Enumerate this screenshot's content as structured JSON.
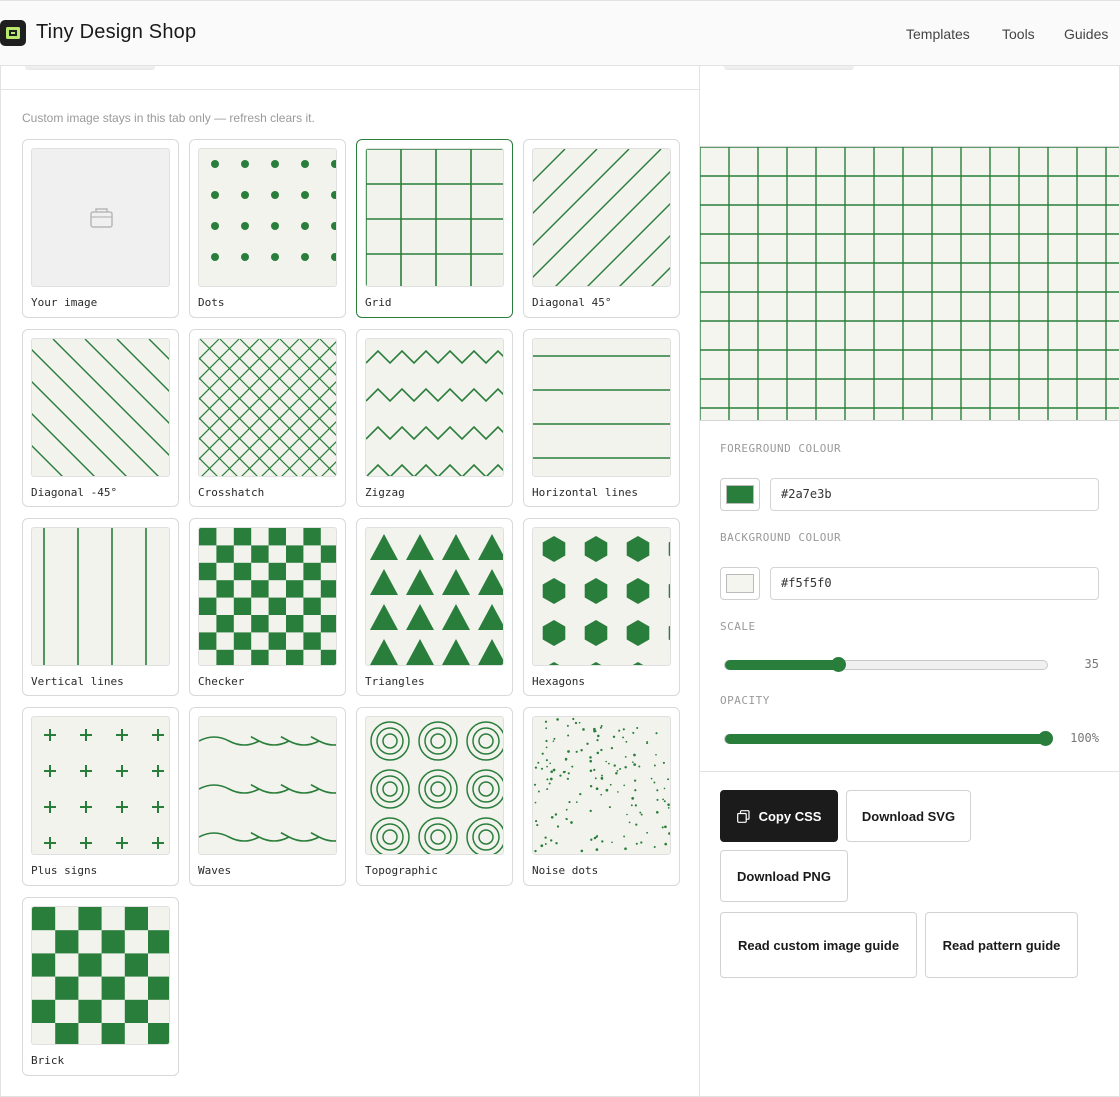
{
  "header": {
    "brand": "Tiny Design Shop",
    "nav": [
      "Templates",
      "Tools",
      "Guides"
    ]
  },
  "gallery": {
    "hint": "Custom image stays in this tab only — refresh clears it.",
    "selected": "Grid",
    "patterns": [
      {
        "label": "Your image"
      },
      {
        "label": "Dots"
      },
      {
        "label": "Grid"
      },
      {
        "label": "Diagonal 45°"
      },
      {
        "label": "Diagonal -45°"
      },
      {
        "label": "Crosshatch"
      },
      {
        "label": "Zigzag"
      },
      {
        "label": "Horizontal lines"
      },
      {
        "label": "Vertical lines"
      },
      {
        "label": "Checker"
      },
      {
        "label": "Triangles"
      },
      {
        "label": "Hexagons"
      },
      {
        "label": "Plus signs"
      },
      {
        "label": "Waves"
      },
      {
        "label": "Topographic"
      },
      {
        "label": "Noise dots"
      },
      {
        "label": "Brick"
      }
    ]
  },
  "controls": {
    "foreground": {
      "label": "FOREGROUND COLOUR",
      "value": "#2a7e3b"
    },
    "background": {
      "label": "BACKGROUND COLOUR",
      "value": "#f5f5f0"
    },
    "scale": {
      "label": "SCALE",
      "value": 35,
      "fraction": 0.35,
      "display": "35"
    },
    "opacity": {
      "label": "OPACITY",
      "value": 100,
      "fraction": 1.0,
      "display": "100%"
    }
  },
  "actions": {
    "copy_css": "Copy CSS",
    "download_svg": "Download SVG",
    "download_png": "Download PNG",
    "custom_guide": "Read custom image guide",
    "pattern_guide": "Read pattern guide"
  },
  "colors": {
    "accent": "#2a7e3b",
    "thumb_bg": "#f3f3ee"
  }
}
